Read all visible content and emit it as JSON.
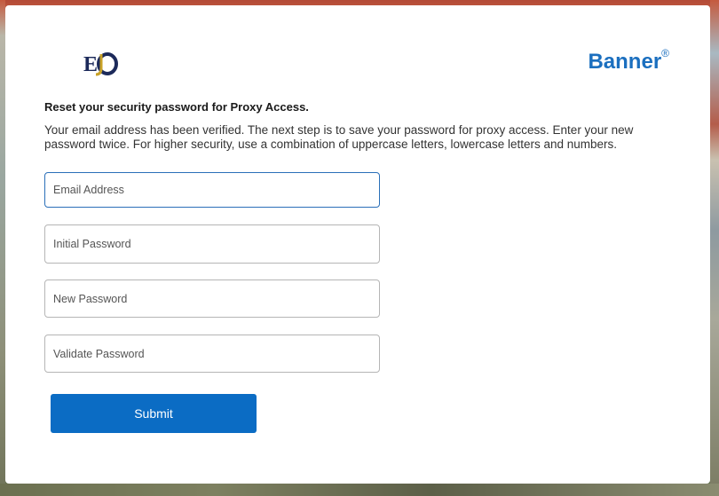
{
  "header": {
    "logo_text": "EO",
    "brand": "Banner",
    "brand_mark": "®"
  },
  "main": {
    "title": "Reset your security password for Proxy Access.",
    "description": "Your email address has been verified. The next step is to save your password for proxy access. Enter your new password twice. For higher security, use a combination of uppercase letters, lowercase letters and numbers.",
    "fields": {
      "email": {
        "placeholder": "Email Address",
        "value": ""
      },
      "initial_password": {
        "placeholder": "Initial Password",
        "value": ""
      },
      "new_password": {
        "placeholder": "New Password",
        "value": ""
      },
      "validate_password": {
        "placeholder": "Validate Password",
        "value": ""
      }
    },
    "submit_label": "Submit"
  },
  "colors": {
    "brand": "#1b6fbf",
    "button": "#0b6cc4",
    "logo_navy": "#1c2a5a",
    "logo_gold": "#c9a227"
  }
}
